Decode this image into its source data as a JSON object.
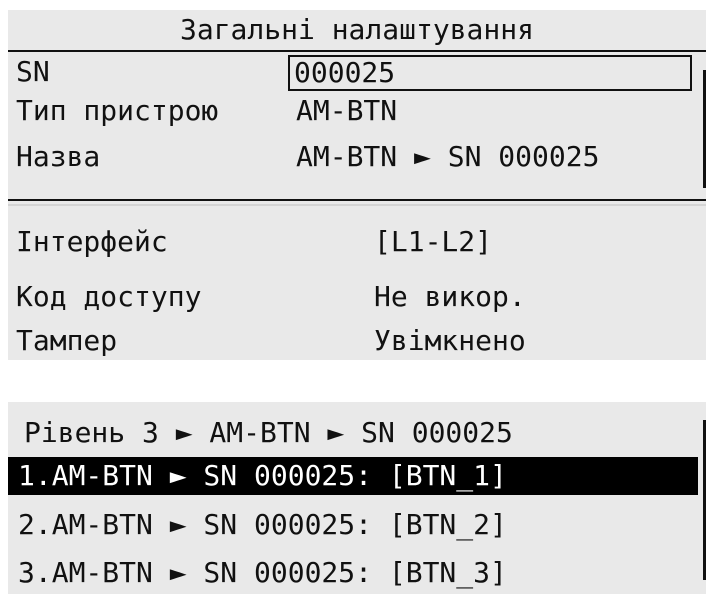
{
  "general_settings": {
    "title": "Загальні налаштування",
    "sn_label": "SN",
    "sn_value": "000025",
    "device_type_label": "Тип пристрою",
    "device_type_value": "AM-BTN",
    "name_label": "Назва",
    "name_value": "AM-BTN ► SN 000025",
    "interface_label": "Інтерфейс",
    "interface_value": "[L1-L2]",
    "access_code_label": "Код доступу",
    "access_code_value": "Не викор.",
    "tamper_label": "Тампер",
    "tamper_value": "Увімкнено"
  },
  "level_menu": {
    "title": "Рівень 3 ► AM-BTN ► SN 000025",
    "items": [
      {
        "label": "1.AM-BTN ► SN 000025: [BTN_1]",
        "selected": true
      },
      {
        "label": "2.AM-BTN ► SN 000025: [BTN_2]",
        "selected": false
      },
      {
        "label": "3.AM-BTN ► SN 000025: [BTN_3]",
        "selected": false
      }
    ]
  },
  "colors": {
    "screen_bg": "#e9e9e9",
    "text": "#111111",
    "highlight_bg": "#000000",
    "highlight_text": "#ffffff"
  }
}
